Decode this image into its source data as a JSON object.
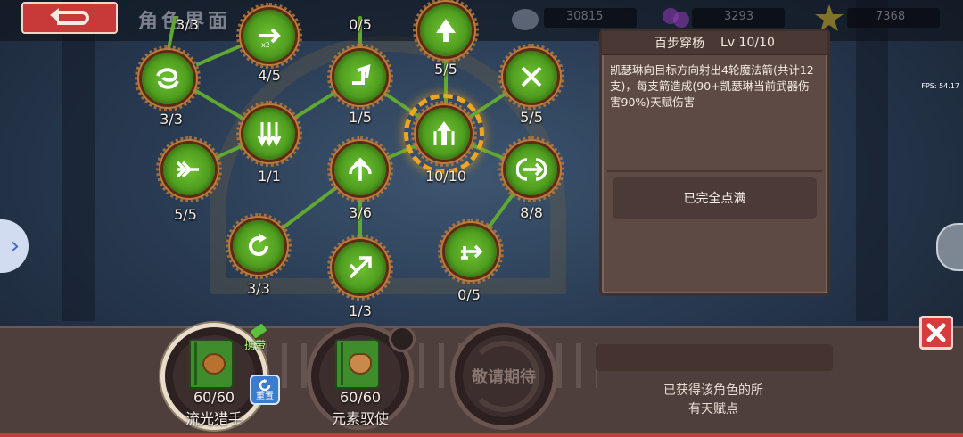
{
  "topbar": {
    "title": "角色界面",
    "resources": [
      {
        "name": "stone-icon",
        "value": "30815"
      },
      {
        "name": "gem-icon",
        "value": "3293"
      },
      {
        "name": "star-icon",
        "value": "7368"
      }
    ]
  },
  "fps_text": "FPS: 54.17",
  "nodes": [
    {
      "level": "3/3"
    },
    {
      "level": "0/5"
    },
    {
      "level": "4/5"
    },
    {
      "level": "5/5"
    },
    {
      "level": "3/3"
    },
    {
      "level": "1/5"
    },
    {
      "level": "5/5"
    },
    {
      "level": "1/1"
    },
    {
      "level": "10/10"
    },
    {
      "level": "5/5"
    },
    {
      "level": "3/6"
    },
    {
      "level": "8/8"
    },
    {
      "level": "3/3"
    },
    {
      "level": "0/5"
    },
    {
      "level": "1/3"
    }
  ],
  "detail": {
    "name": "百步穿杨",
    "level": "Lv 10/10",
    "description": "凯瑟琳向目标方向射出4轮魔法箭(共计12支)，每支箭造成(90+凯瑟琳当前武器伤害90%)天赋伤害",
    "status_button": "已完全点满"
  },
  "books": [
    {
      "count": "60/60",
      "name": "流光猎手",
      "carry_label": "携带",
      "reroll_label": "重置"
    },
    {
      "count": "60/60",
      "name": "元素驭使"
    },
    {
      "locked_label": "敬请期待"
    }
  ],
  "info": {
    "line1": "已获得该角色的所",
    "line2": "有天赋点"
  },
  "colors": {
    "node_green": "#4f9d1f",
    "node_frame": "#a6572a",
    "selected_ring": "#f0a51f",
    "link_line": "#5fa832",
    "close_red": "#d83b3b"
  }
}
